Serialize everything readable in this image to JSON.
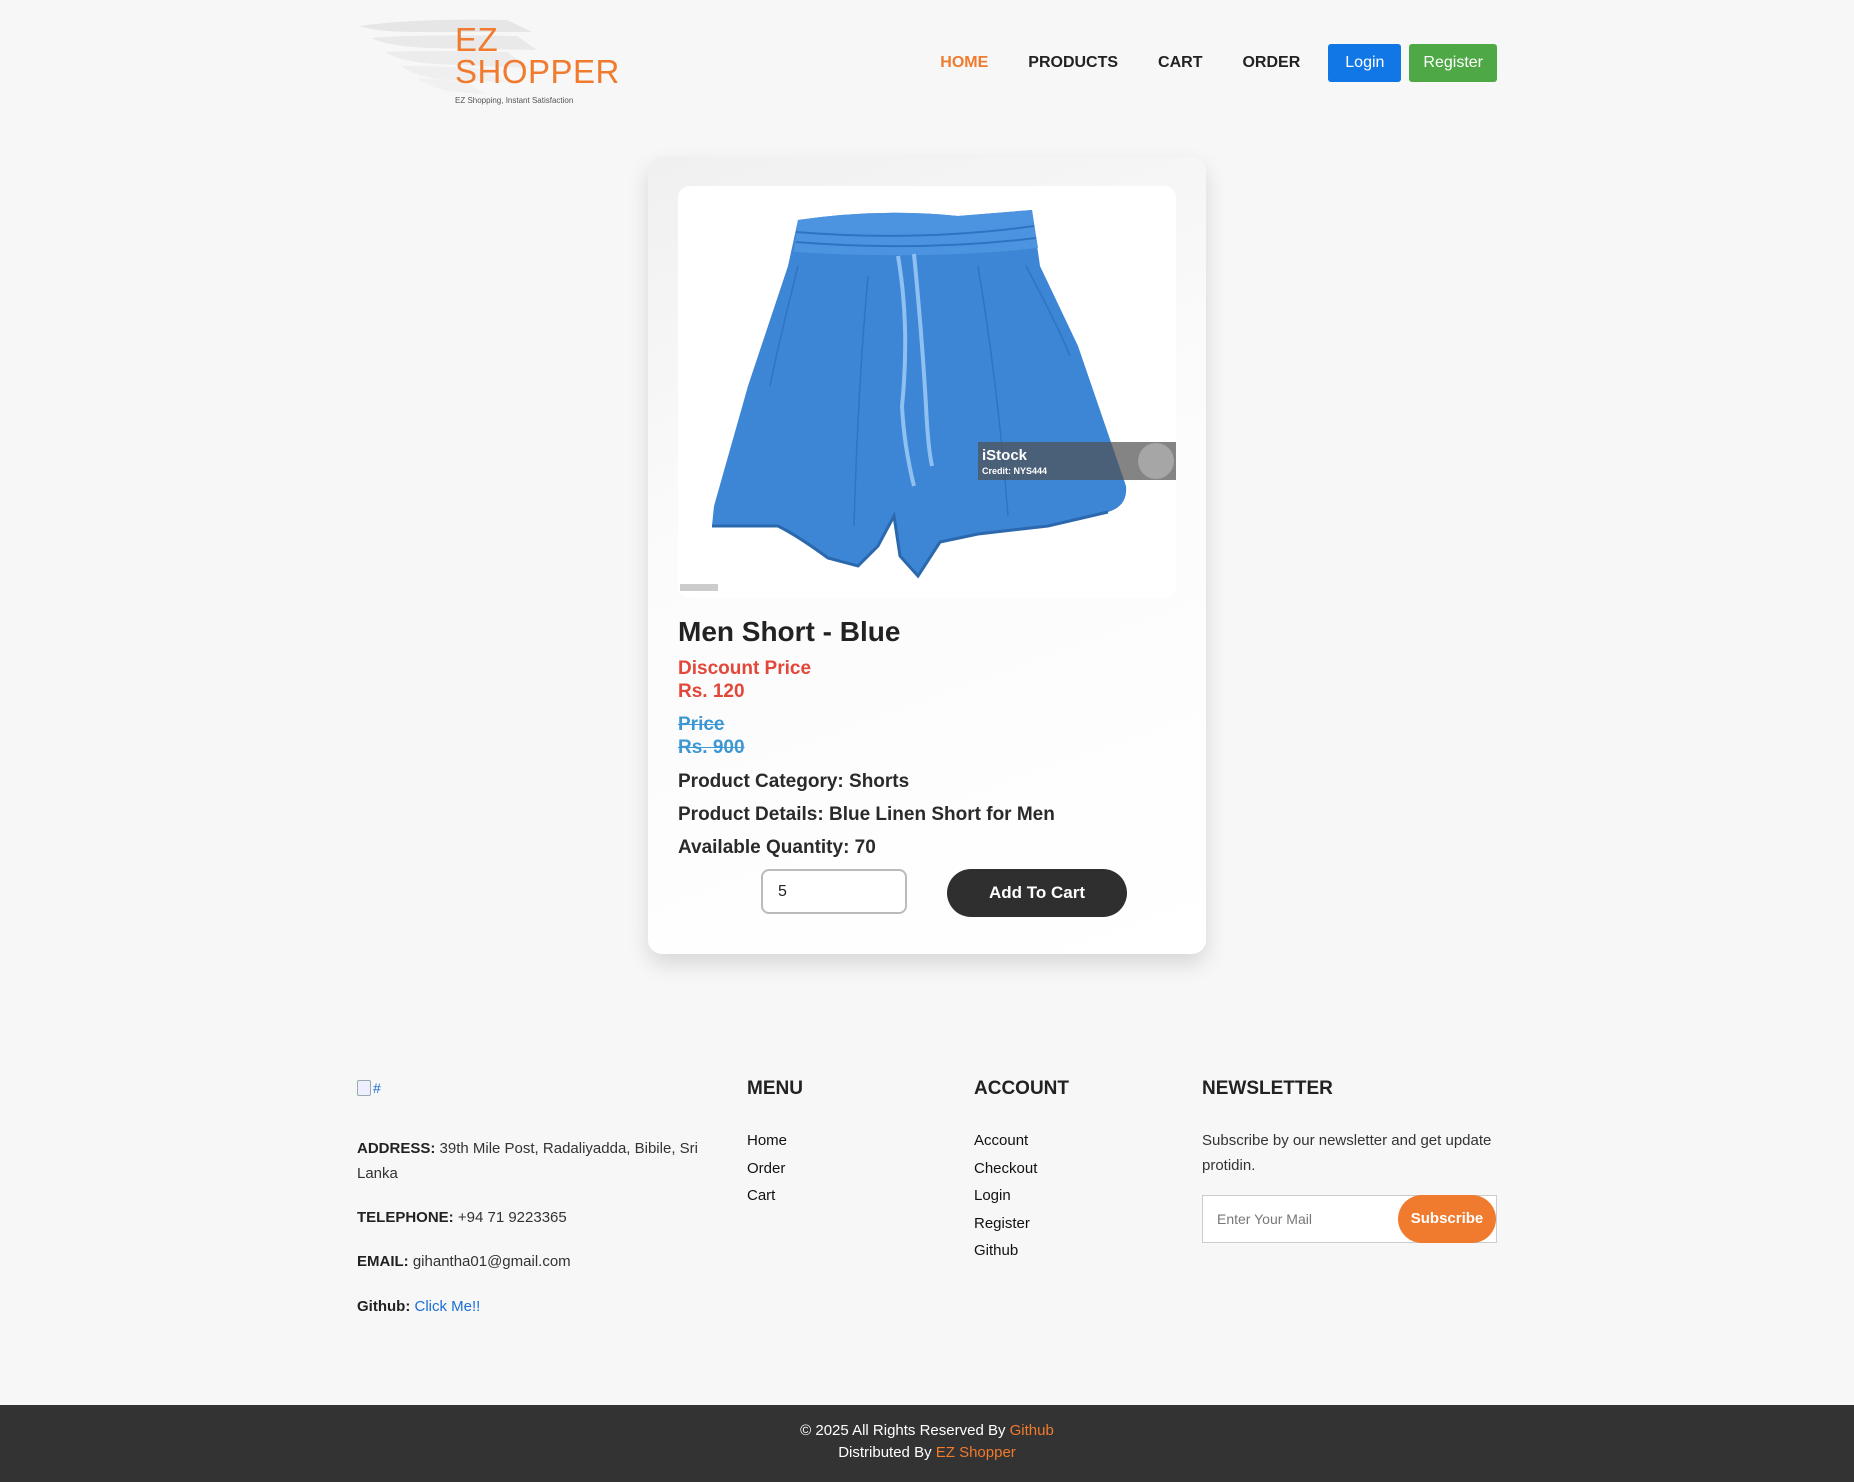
{
  "header": {
    "logo_text_line1": "EZ",
    "logo_text_line2": "SHOPPER",
    "logo_tagline": "EZ Shopping, Instant Satisfaction",
    "nav": [
      "HOME",
      "PRODUCTS",
      "CART",
      "ORDER"
    ],
    "login_label": "Login",
    "register_label": "Register"
  },
  "product": {
    "image_watermark": "iStock",
    "image_credit": "Credit: NYS444",
    "title": "Men Short - Blue",
    "discount_label": "Discount Price",
    "discount_value": "Rs. 120",
    "price_label": "Price",
    "price_value": "Rs. 900",
    "category": "Product Category: Shorts",
    "details": "Product Details: Blue Linen Short for Men",
    "quantity": "Available Quantity: 70",
    "qty_input_value": "5",
    "add_to_cart_label": "Add To Cart"
  },
  "footer": {
    "logo_alt": "#",
    "address_label": "ADDRESS:",
    "address_value": "39th Mile Post, Radaliyadda, Bibile, Sri Lanka",
    "telephone_label": "TELEPHONE:",
    "telephone_value": "+94 71 9223365",
    "email_label": "EMAIL:",
    "email_value": "gihantha01@gmail.com",
    "github_label": "Github:",
    "github_link": "Click Me!!",
    "menu_heading": "MENU",
    "menu_items": [
      "Home",
      "Order",
      "Cart"
    ],
    "account_heading": "ACCOUNT",
    "account_items": [
      "Account",
      "Checkout",
      "Login",
      "Register",
      "Github"
    ],
    "newsletter_heading": "NEWSLETTER",
    "newsletter_text": "Subscribe by our newsletter and get update protidin.",
    "newsletter_placeholder": "Enter Your Mail",
    "subscribe_label": "Subscribe"
  },
  "bottom": {
    "copyright_prefix": "© 2025 All Rights Reserved By",
    "copyright_link": "Github",
    "distributed_prefix": "Distributed By",
    "distributed_link": "EZ Shopper"
  },
  "colors": {
    "accent_orange": "#f07a2d",
    "login_blue": "#1177e6",
    "register_green": "#4ea845",
    "discount_red": "#e2473a",
    "price_blue": "#3d97d3",
    "dark": "#333333"
  }
}
